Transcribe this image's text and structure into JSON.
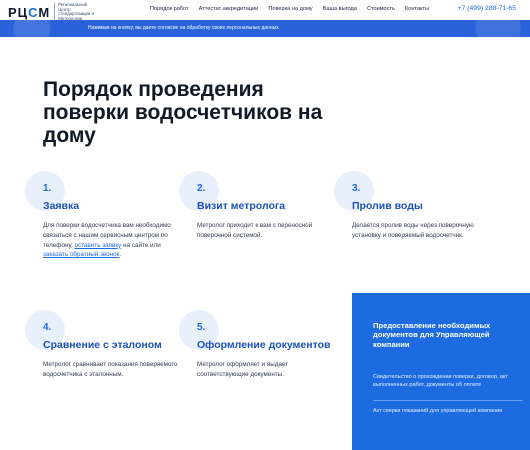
{
  "header": {
    "logo_text_1": "РЦ",
    "logo_text_2": "С",
    "logo_text_3": "М",
    "logo_sub": "Региональный Центр стандартизации и Метрологии",
    "nav": [
      "Порядок работ",
      "Аттестат аккредитации",
      "Поверка на дому",
      "Ваша выгода",
      "Стоимость",
      "Контакты"
    ],
    "phone": "+7 (499) 288-71-65"
  },
  "banner": {
    "text": "Нажимая на кнопку, вы даете согласие на обработку своих персональных данных"
  },
  "page": {
    "title": "Порядок проведения поверки водосчетчиков на дому"
  },
  "steps": [
    {
      "num": "1.",
      "title": "Заявка",
      "desc_before": "Для поверки водосчетчика вам необходимо связаться с нашим сервисным центром по телефону,",
      "link1": "оставить заявку",
      "desc_mid": "на сайте или",
      "link2": "заказать обратный звонок",
      "desc_after": "."
    },
    {
      "num": "2.",
      "title": "Визит метролога",
      "desc": "Метролог приходит к вам с переносной поверочной системой."
    },
    {
      "num": "3.",
      "title": "Пролив воды",
      "desc": "Делается пролив воды через поверочную установку и поверяемый водосчетчик."
    },
    {
      "num": "4.",
      "title": "Сравнение с эталоном",
      "desc": "Метролог сравнивает показания поверяемого водосчетчика с эталонным."
    },
    {
      "num": "5.",
      "title": "Оформление документов",
      "desc": "Метролог оформляет и выдает соответствующие документы."
    }
  ],
  "card": {
    "title": "Предоставление необходимых документов для Управляющей компании",
    "items": [
      "Свидетельство о прохождении поверки, договор, акт выполненных работ, документы об оплате",
      "Акт сверки показаний для управляющей компании"
    ]
  },
  "colors": {
    "accent": "#1c6be0",
    "banner": "#2a62d9",
    "badge": "#e7f0fb"
  }
}
